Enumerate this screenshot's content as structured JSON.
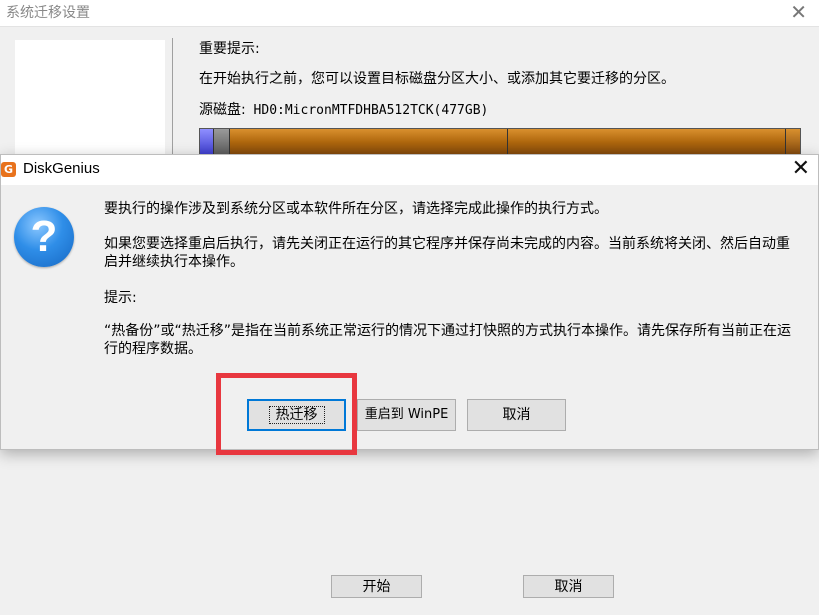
{
  "background_window": {
    "title": "系统迁移设置",
    "heading": "重要提示:",
    "instruction": "在开始执行之前，您可以设置目标磁盘分区大小、或添加其它要迁移的分区。",
    "source_disk_label": "源磁盘:",
    "source_disk_value": "HD0:MicronMTFDHBA512TCK(477GB)",
    "buttons": {
      "start": "开始",
      "cancel": "取消"
    }
  },
  "dialog": {
    "title": "DiskGenius",
    "icon": "question-icon",
    "messages": {
      "line1": "要执行的操作涉及到系统分区或本软件所在分区，请选择完成此操作的执行方式。",
      "line2": "如果您要选择重启后执行，请先关闭正在运行的其它程序并保存尚未完成的内容。当前系统将关闭、然后自动重启并继续执行本操作。",
      "hint_label": "提示:",
      "hint": "“热备份”或“热迁移”是指在当前系统正常运行的情况下通过打快照的方式执行本操作。请先保存所有当前正在运行的程序数据。"
    },
    "buttons": {
      "hot_migrate": "热迁移",
      "reboot_winpe": "重启到 WinPE",
      "cancel": "取消"
    }
  },
  "colors": {
    "highlight": "#e8373f",
    "focus_border": "#0078d7",
    "partition_primary": "#b0680e"
  }
}
